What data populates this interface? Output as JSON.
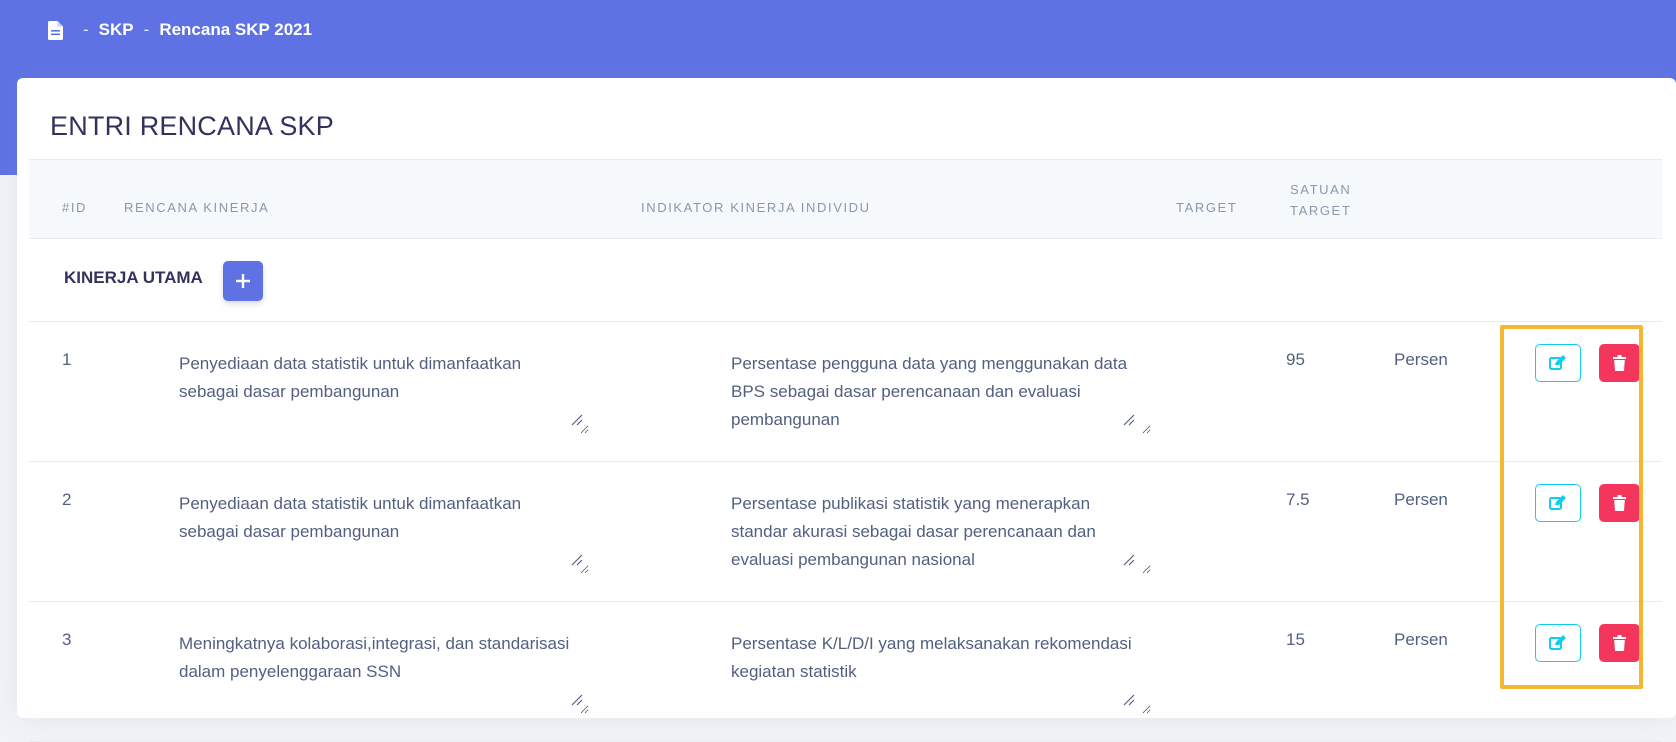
{
  "breadcrumb": {
    "separator": "-",
    "first": "SKP",
    "second": "Rencana SKP 2021"
  },
  "page_title": "ENTRI RENCANA SKP",
  "columns": {
    "id": "#ID",
    "rencana": "RENCANA KINERJA",
    "indikator": "INDIKATOR KINERJA INDIVIDU",
    "target": "TARGET",
    "satuan_line1": "SATUAN",
    "satuan_line2": "TARGET"
  },
  "section": {
    "label": "KINERJA UTAMA"
  },
  "rows": [
    {
      "id": "1",
      "rencana": "Penyediaan data statistik untuk dimanfaatkan sebagai dasar pembangunan",
      "indikator": "Persentase pengguna data yang menggunakan data BPS sebagai dasar perencanaan dan evaluasi pembangunan",
      "target": "95",
      "satuan": "Persen"
    },
    {
      "id": "2",
      "rencana": "Penyediaan data statistik untuk dimanfaatkan sebagai dasar pembangunan",
      "indikator": "Persentase publikasi statistik yang menerapkan standar akurasi sebagai dasar perencanaan dan evaluasi pembangunan nasional",
      "target": "7.5",
      "satuan": "Persen"
    },
    {
      "id": "3",
      "rencana": "Meningkatnya kolaborasi,integrasi, dan standarisasi dalam penyelenggaraan SSN",
      "indikator": "Persentase K/L/D/I yang melaksanakan rekomendasi kegiatan statistik",
      "target": "15",
      "satuan": "Persen"
    }
  ],
  "colors": {
    "primary": "#5e72e4",
    "info": "#11cdef",
    "danger": "#f5365c",
    "highlight": "#f5b731"
  },
  "icons": {
    "breadcrumb": "file-icon",
    "add": "plus-icon",
    "edit": "edit-icon",
    "delete": "trash-icon"
  }
}
